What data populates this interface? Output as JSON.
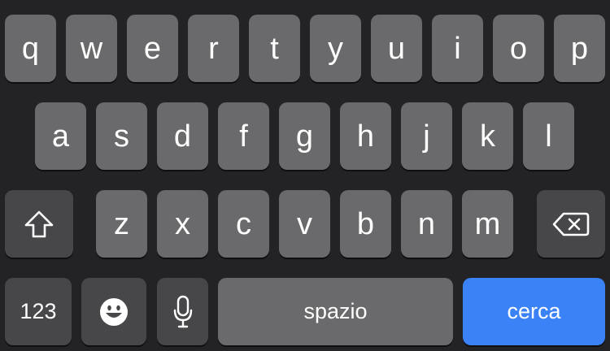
{
  "keyboard": {
    "row1": [
      "q",
      "w",
      "e",
      "r",
      "t",
      "y",
      "u",
      "i",
      "o",
      "p"
    ],
    "row2": [
      "a",
      "s",
      "d",
      "f",
      "g",
      "h",
      "j",
      "k",
      "l"
    ],
    "row3": [
      "z",
      "x",
      "c",
      "v",
      "b",
      "n",
      "m"
    ],
    "numbers_label": "123",
    "space_label": "spazio",
    "search_label": "cerca",
    "icons": {
      "shift": "shift-icon",
      "backspace": "backspace-icon",
      "emoji": "emoji-icon",
      "mic": "microphone-icon"
    },
    "colors": {
      "background": "#232325",
      "key": "#6a6a6c",
      "function_key": "#474749",
      "search_key": "#3b82f6",
      "text": "#ffffff"
    }
  }
}
